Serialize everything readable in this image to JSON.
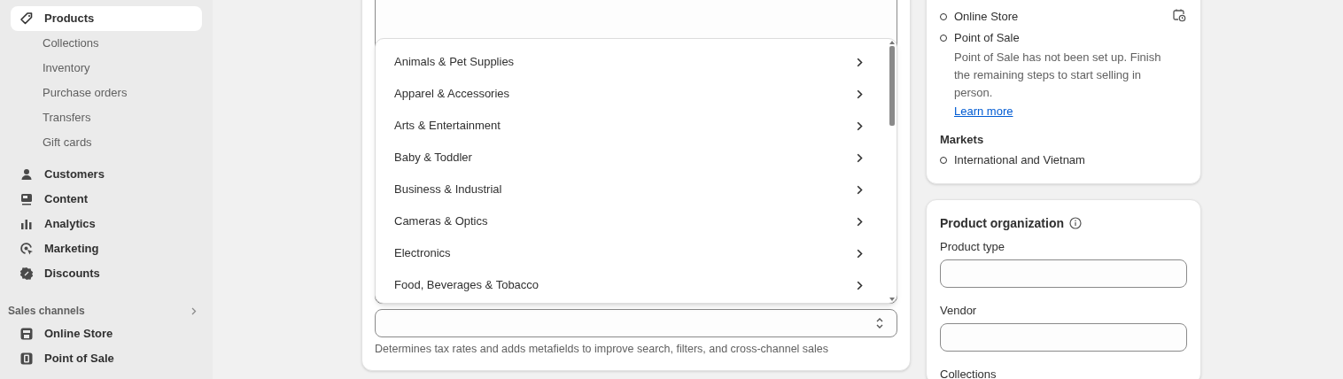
{
  "sidebar": {
    "items": [
      {
        "label": "Products",
        "selected": true,
        "children": [
          {
            "label": "Collections",
            "selected": false
          },
          {
            "label": "Inventory",
            "selected": false
          },
          {
            "label": "Purchase orders",
            "selected": false
          },
          {
            "label": "Transfers",
            "selected": false
          },
          {
            "label": "Gift cards",
            "selected": false
          }
        ]
      },
      {
        "label": "Customers",
        "selected": false
      },
      {
        "label": "Content",
        "selected": false
      },
      {
        "label": "Analytics",
        "selected": false
      },
      {
        "label": "Marketing",
        "selected": false
      },
      {
        "label": "Discounts",
        "selected": false
      }
    ],
    "sales_channels": {
      "title": "Sales channels",
      "items": [
        {
          "label": "Online Store",
          "selected": false
        },
        {
          "label": "Point of Sale",
          "selected": false
        }
      ]
    }
  },
  "category_dropdown": {
    "options": [
      {
        "label": "Animals & Pet Supplies"
      },
      {
        "label": "Apparel & Accessories"
      },
      {
        "label": "Arts & Entertainment"
      },
      {
        "label": "Baby & Toddler"
      },
      {
        "label": "Business & Industrial"
      },
      {
        "label": "Cameras & Optics"
      },
      {
        "label": "Electronics"
      },
      {
        "label": "Food, Beverages & Tobacco"
      }
    ]
  },
  "category_help": "Determines tax rates and adds metafields to improve search, filters, and cross-channel sales",
  "publishing": {
    "channels": [
      {
        "label": "Online Store",
        "checked": false
      },
      {
        "label": "Point of Sale",
        "checked": false,
        "note": "Point of Sale has not been set up. Finish the remaining steps to start selling in person.",
        "link": "Learn more"
      }
    ],
    "markets_title": "Markets",
    "markets": [
      {
        "label": "International and Vietnam",
        "checked": false
      }
    ]
  },
  "product_organization": {
    "title": "Product organization",
    "fields": [
      {
        "label": "Product type"
      },
      {
        "label": "Vendor"
      },
      {
        "label": "Collections"
      }
    ]
  }
}
